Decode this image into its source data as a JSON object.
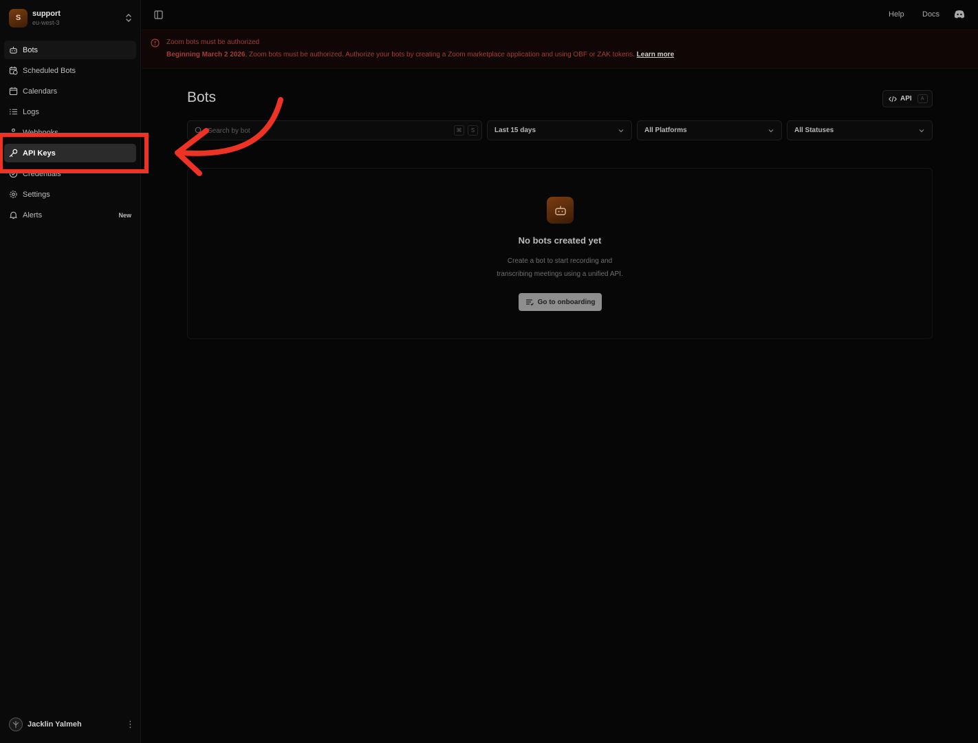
{
  "workspace": {
    "initial": "S",
    "name": "support",
    "region": "eu-west-3"
  },
  "sidebar": {
    "items": [
      {
        "label": "Bots",
        "icon": "bot-icon"
      },
      {
        "label": "Scheduled Bots",
        "icon": "calendar-clock-icon"
      },
      {
        "label": "Calendars",
        "icon": "calendar-icon"
      },
      {
        "label": "Logs",
        "icon": "list-icon"
      },
      {
        "label": "Webhooks",
        "icon": "webhook-icon"
      },
      {
        "label": "API Keys",
        "icon": "key-icon"
      },
      {
        "label": "Credentials",
        "icon": "shield-icon"
      },
      {
        "label": "Settings",
        "icon": "gear-icon"
      },
      {
        "label": "Alerts",
        "icon": "bell-icon",
        "badge": "New"
      }
    ]
  },
  "user": {
    "name": "Jacklin Yalmeh"
  },
  "topbar": {
    "help": "Help",
    "docs": "Docs"
  },
  "banner": {
    "title": "Zoom bots must be authorized",
    "body_bold": "Beginning March 2 2026",
    "body_text": ", Zoom bots must be authorized. Authorize your bots by creating a Zoom marketplace application and using OBF or ZAK tokens. ",
    "link": "Learn more"
  },
  "main": {
    "title": "Bots",
    "api_button": {
      "label": "API",
      "shortcut": "A"
    },
    "search": {
      "placeholder": "Search by bot",
      "shortcut_mod": "⌘",
      "shortcut_key": "S"
    },
    "filters": {
      "date": "Last 15 days",
      "platform": "All Platforms",
      "status": "All Statuses"
    },
    "empty": {
      "title": "No bots created yet",
      "line1": "Create a bot to start recording and",
      "line2": "transcribing meetings using a unified API.",
      "button": "Go to onboarding"
    }
  },
  "colors": {
    "annotation": "#ee3224",
    "banner_text": "#a63c33",
    "brand": "#7a3d10"
  }
}
